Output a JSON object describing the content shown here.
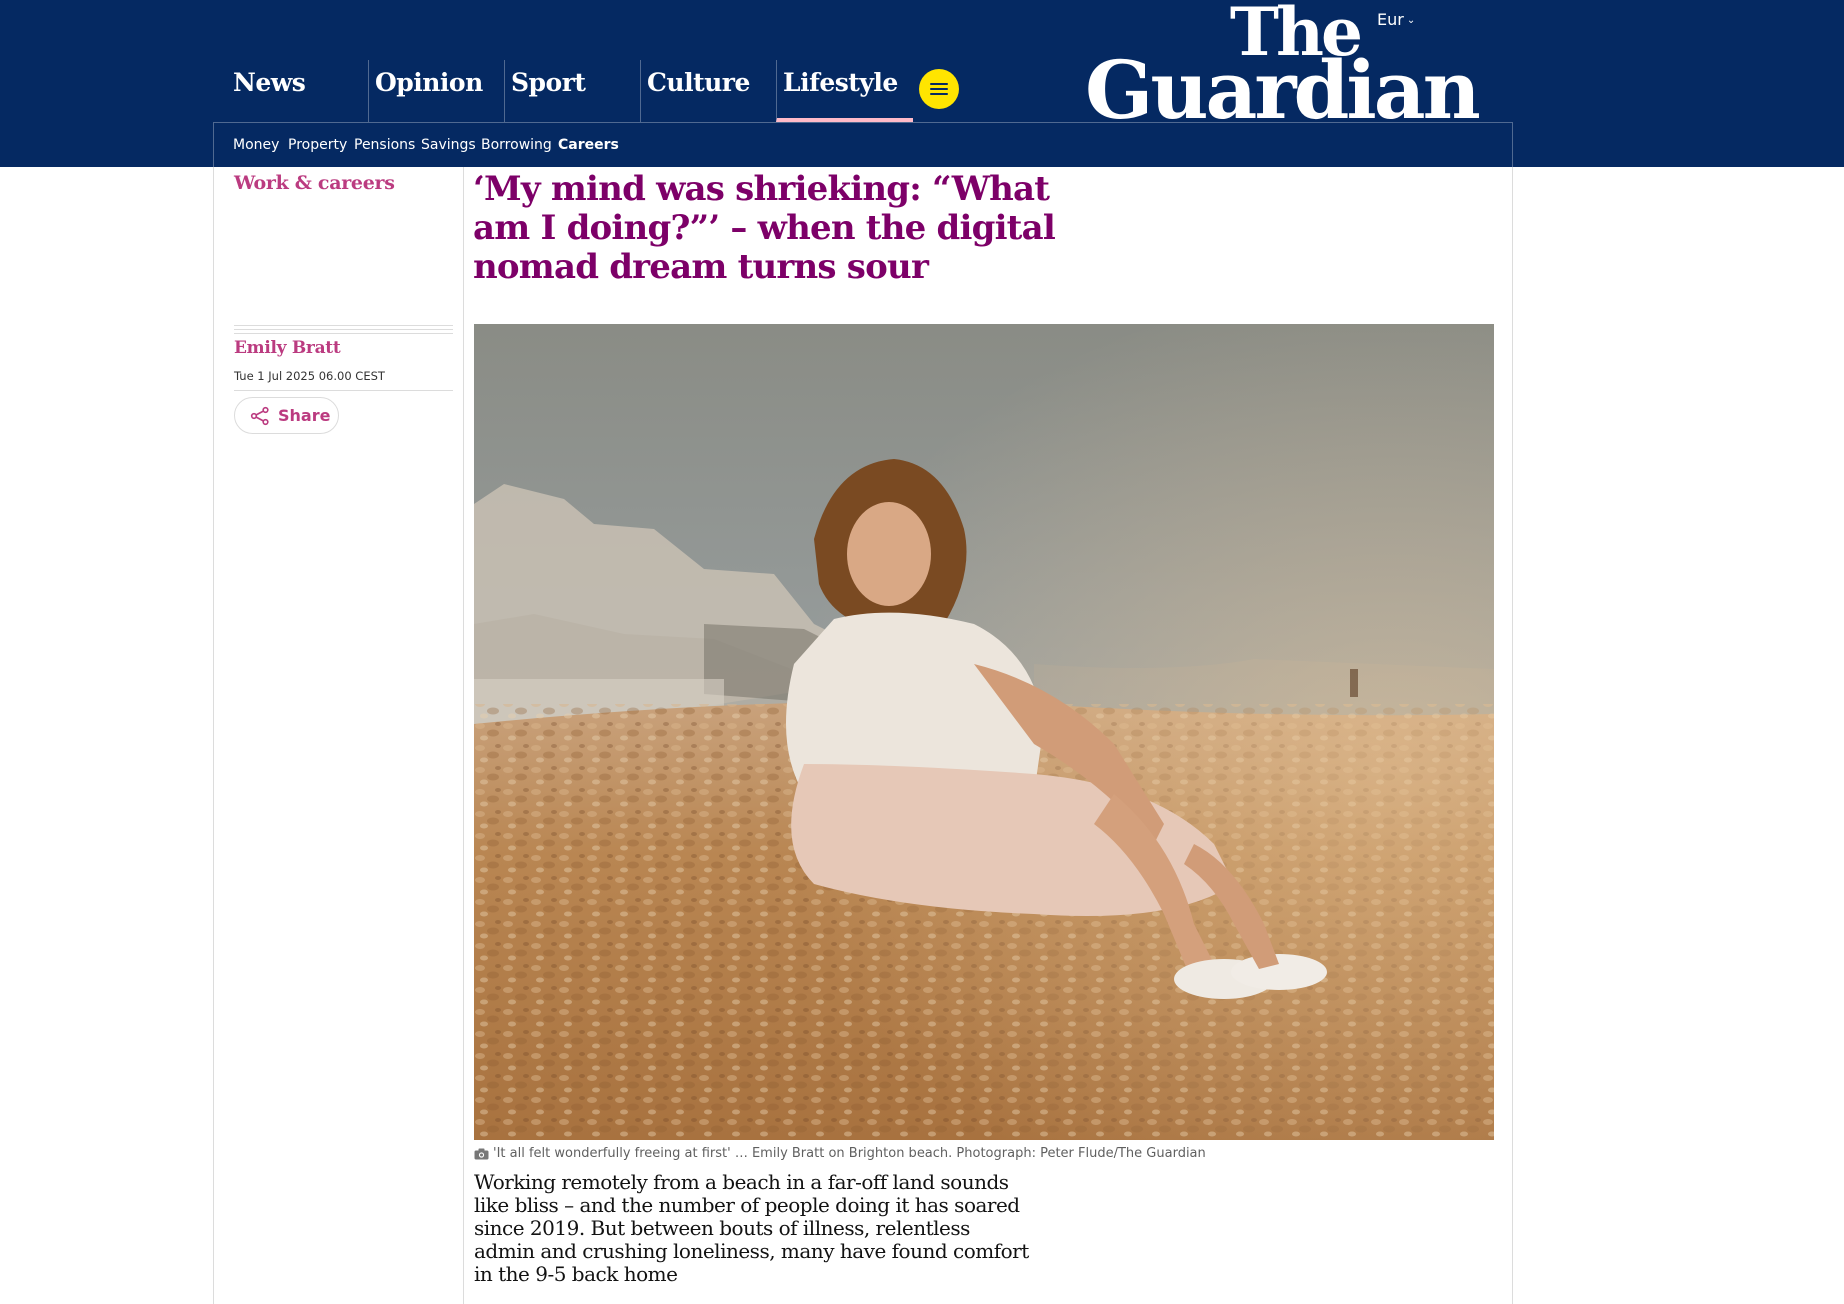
{
  "header": {
    "edition": "Eur",
    "logo_line1": "The",
    "logo_line2": "Guardian",
    "pillars": [
      {
        "label": "News"
      },
      {
        "label": "Opinion"
      },
      {
        "label": "Sport"
      },
      {
        "label": "Culture"
      },
      {
        "label": "Lifestyle"
      }
    ],
    "subnav": [
      "Money",
      "Property",
      "Pensions",
      "Savings",
      "Borrowing",
      "Careers"
    ]
  },
  "article": {
    "section": "Work & careers",
    "headline": "‘My mind was shrieking: “What am I doing?”’ – when the digital nomad dream turns sour",
    "author": "Emily Bratt",
    "date": "Tue 1 Jul 2025 06.00 CEST",
    "share_label": "Share",
    "caption": "'It all felt wonderfully freeing at first' … Emily Bratt on Brighton beach. Photograph: Peter Flude/The Guardian",
    "standfirst": "Working remotely from a beach in a far-off land sounds like bliss – and the number of people doing it has soared since 2019. But between bouts of illness, relentless admin and crushing loneliness, many have found comfort in the 9-5 back home"
  },
  "colors": {
    "brand_navy": "#052962",
    "lifestyle_accent": "#bb3b80",
    "headline": "#7d0068",
    "menu_yellow": "#ffe500",
    "active_underline": "#ffbac8"
  },
  "icons": {
    "menu": "hamburger-icon",
    "share": "share-icon",
    "caption": "camera-icon",
    "edition": "chevron-down-icon"
  }
}
